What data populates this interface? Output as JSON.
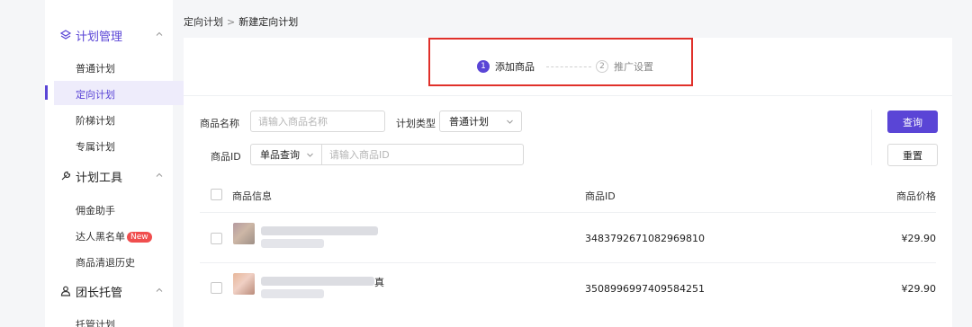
{
  "sidebar": {
    "groups": [
      {
        "label": "计划管理",
        "icon": "layers-icon"
      },
      {
        "label": "计划工具",
        "icon": "tools-icon"
      },
      {
        "label": "团长托管",
        "icon": "team-icon"
      }
    ],
    "plan_items": [
      "普通计划",
      "定向计划",
      "阶梯计划",
      "专属计划"
    ],
    "tool_items": [
      "佣金助手",
      "达人黑名单",
      "商品清退历史"
    ],
    "new_badge": "New",
    "host_items": [
      "托管计划"
    ]
  },
  "breadcrumb": {
    "parent": "定向计划",
    "separator": ">",
    "current": "新建定向计划"
  },
  "steps": [
    {
      "num": "1",
      "label": "添加商品",
      "active": true
    },
    {
      "num": "2",
      "label": "推广设置",
      "active": false
    }
  ],
  "filters": {
    "name_label": "商品名称",
    "name_placeholder": "请输入商品名称",
    "type_label": "计划类型",
    "type_value": "普通计划",
    "id_label": "商品ID",
    "id_mode": "单品查询",
    "id_placeholder": "请输入商品ID",
    "query_button": "查询",
    "reset_button": "重置"
  },
  "table": {
    "headers": [
      "商品信息",
      "商品ID",
      "商品价格"
    ],
    "rows": [
      {
        "product_tail": "",
        "product_id": "3483792671082969810",
        "price": "¥29.90"
      },
      {
        "product_tail": "真",
        "product_id": "3508996997409584251",
        "price": "¥29.90"
      }
    ]
  },
  "colors": {
    "accent": "#5a45d6",
    "highlight_box": "#e0302a",
    "badge": "#f04e4e"
  }
}
